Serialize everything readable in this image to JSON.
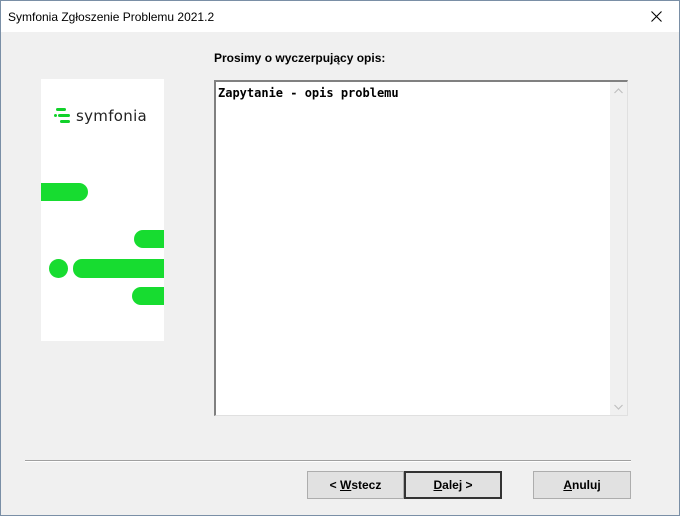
{
  "window": {
    "title": "Symfonia Zgłoszenie Problemu 2021.2"
  },
  "logo": {
    "text": "symfonia"
  },
  "form": {
    "description_label": "Prosimy o wyczerpujący opis:",
    "description_value": "Zapytanie - opis problemu"
  },
  "buttons": {
    "back": {
      "mnemonic": "W",
      "prefix": "< ",
      "rest": "stecz"
    },
    "next": {
      "mnemonic": "D",
      "rest": "alej",
      "suffix": " >"
    },
    "cancel": {
      "mnemonic": "A",
      "rest": "nuluj"
    }
  },
  "colors": {
    "brand_green": "#17dc30"
  }
}
